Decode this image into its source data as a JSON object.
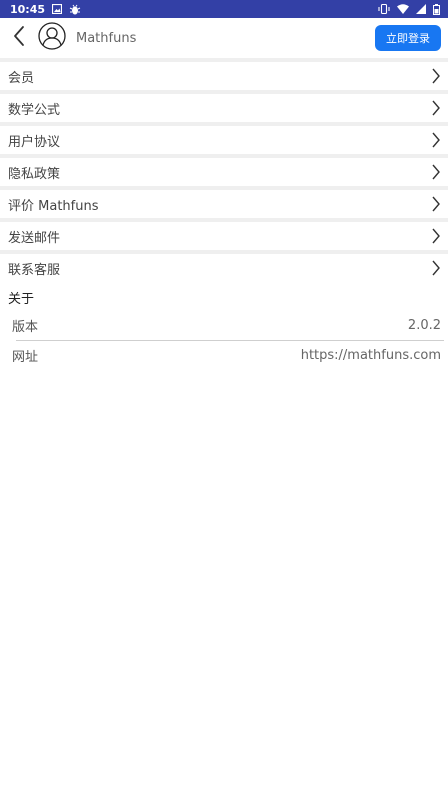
{
  "status_bar": {
    "time": "10:45",
    "left_icons": [
      "notification-image-icon",
      "bug-icon"
    ],
    "right_icons": [
      "vibrate-icon",
      "wifi-icon",
      "signal-icon",
      "battery-icon"
    ],
    "background": "#3340a6"
  },
  "header": {
    "back_icon": "chevron-left-icon",
    "avatar_icon": "user-avatar-icon",
    "user_name": "Mathfuns",
    "login_label": "立即登录",
    "accent": "#1877f2"
  },
  "menu": {
    "items": [
      {
        "label": "会员"
      },
      {
        "label": "数学公式"
      },
      {
        "label": "用户协议"
      },
      {
        "label": "隐私政策"
      },
      {
        "label": "评价 Mathfuns"
      },
      {
        "label": "发送邮件"
      },
      {
        "label": "联系客服"
      }
    ]
  },
  "about": {
    "title": "关于",
    "rows": [
      {
        "label": "版本",
        "value": "2.0.2"
      },
      {
        "label": "网址",
        "value": "https://mathfuns.com"
      }
    ]
  }
}
